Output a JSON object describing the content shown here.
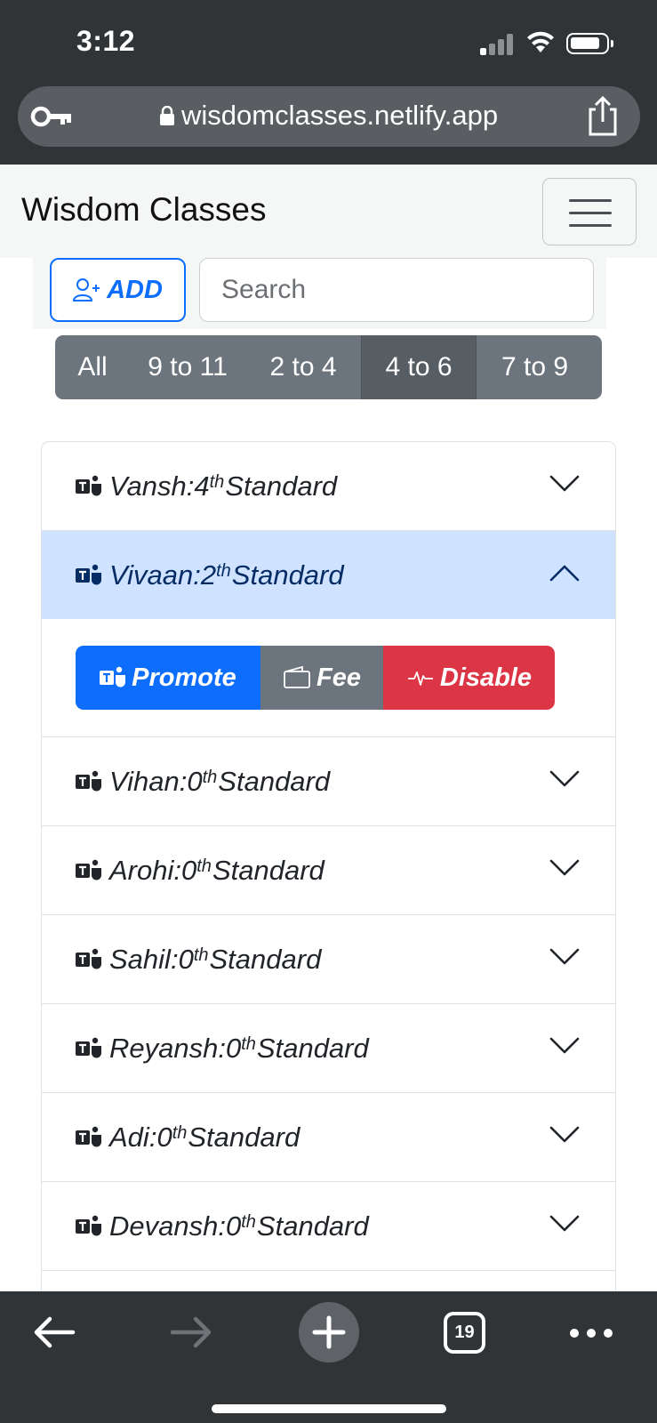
{
  "status_bar": {
    "time": "3:12"
  },
  "browser": {
    "url": "wisdomclasses.netlify.app",
    "tab_count": "19"
  },
  "navbar": {
    "brand": "Wisdom Classes"
  },
  "toolbar": {
    "add_label": "ADD",
    "search_placeholder": "Search"
  },
  "filters": [
    {
      "label": "All",
      "active": false
    },
    {
      "label": "9 to 11",
      "active": false
    },
    {
      "label": "2 to 4",
      "active": false
    },
    {
      "label": "4 to 6",
      "active": true
    },
    {
      "label": "7 to 9",
      "active": false
    }
  ],
  "students": [
    {
      "name": "Vansh",
      "separator": " : ",
      "standard": "4",
      "suffix": "th",
      "standard_label": " Standard",
      "open": false
    },
    {
      "name": "Vivaan",
      "separator": " : ",
      "standard": "2",
      "suffix": "th",
      "standard_label": " Standard",
      "open": true
    },
    {
      "name": "Vihan",
      "separator": " : ",
      "standard": "0",
      "suffix": "th",
      "standard_label": " Standard",
      "open": false
    },
    {
      "name": "Arohi",
      "separator": " : ",
      "standard": "0",
      "suffix": "th",
      "standard_label": " Standard",
      "open": false
    },
    {
      "name": "Sahil",
      "separator": " : ",
      "standard": "0",
      "suffix": "th",
      "standard_label": " Standard",
      "open": false
    },
    {
      "name": "Reyansh",
      "separator": " : ",
      "standard": "0",
      "suffix": "th",
      "standard_label": " Standard",
      "open": false
    },
    {
      "name": "Adi",
      "separator": " : ",
      "standard": "0",
      "suffix": "th",
      "standard_label": " Standard",
      "open": false
    },
    {
      "name": "Devansh",
      "separator": " : ",
      "standard": "0",
      "suffix": "th",
      "standard_label": " Standard",
      "open": false
    }
  ],
  "actions": {
    "promote": "Promote",
    "fee": "Fee",
    "disable": "Disable"
  },
  "colors": {
    "primary": "#0d6efd",
    "secondary": "#6c757d",
    "danger": "#dc3545",
    "open_row": "#cfe2ff"
  }
}
